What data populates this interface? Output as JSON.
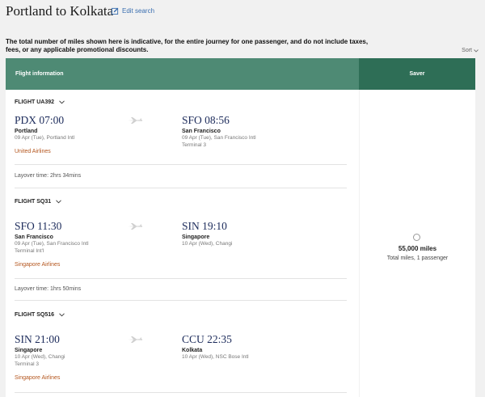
{
  "route_title": "Portland to Kolkata",
  "edit_search": "Edit search",
  "notice": "The total number of miles shown here is indicative, for the entire journey for one passenger, and do not include taxes, fees, or any applicable promotional discounts.",
  "sort_label": "Sort",
  "header": {
    "flight_info": "Flight information",
    "fare_class": "Saver"
  },
  "segments": [
    {
      "flight": "FLIGHT UA392",
      "dep": {
        "time": "PDX 07:00",
        "city": "Portland",
        "detail1": "09 Apr (Tue), Portland Intl",
        "detail2": ""
      },
      "arr": {
        "time": "SFO 08:56",
        "city": "San Francisco",
        "detail1": "09 Apr (Tue), San Francisco Intl",
        "detail2": "Terminal 3"
      },
      "airline": "United Airlines",
      "layover": "Layover time: 2hrs 34mins"
    },
    {
      "flight": "FLIGHT SQ31",
      "dep": {
        "time": "SFO 11:30",
        "city": "San Francisco",
        "detail1": "09 Apr (Tue), San Francisco Intl",
        "detail2": "Terminal Int'l"
      },
      "arr": {
        "time": "SIN 19:10",
        "city": "Singapore",
        "detail1": "10 Apr (Wed), Changi",
        "detail2": ""
      },
      "airline": "Singapore Airlines",
      "layover": "Layover time: 1hrs 50mins"
    },
    {
      "flight": "FLIGHT SQ516",
      "dep": {
        "time": "SIN 21:00",
        "city": "Singapore",
        "detail1": "10 Apr (Wed), Changi",
        "detail2": "Terminal 3"
      },
      "arr": {
        "time": "CCU 22:35",
        "city": "Kolkata",
        "detail1": "10 Apr (Wed), NSC Bose Intl",
        "detail2": ""
      },
      "airline": "Singapore Airlines",
      "layover": ""
    }
  ],
  "fare": {
    "miles": "55,000 miles",
    "sub": "Total miles, 1 passenger"
  },
  "colors": {
    "header_info": "#4e8a74",
    "header_saver": "#2e6e56",
    "airline_text": "#b4561e",
    "time_text": "#1b2a5a",
    "link": "#3a6fb0"
  },
  "icons": {
    "edit": "pencil-square-icon",
    "sort": "chevron-down-icon",
    "plane": "plane-icon"
  }
}
